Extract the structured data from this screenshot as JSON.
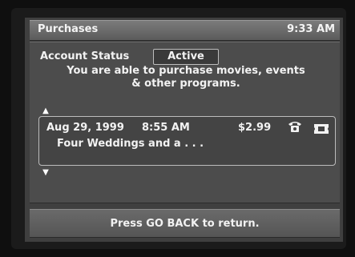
{
  "header": {
    "title": "Purchases",
    "time": "9:33 AM"
  },
  "account": {
    "status_label": "Account Status",
    "status_value": "Active",
    "message_line1": "You are able to purchase movies, events",
    "message_line2": "& other programs."
  },
  "scroll": {
    "up_icon": "triangle-up-icon",
    "down_icon": "triangle-down-icon"
  },
  "purchases": [
    {
      "date": "Aug 29, 1999",
      "time": "8:55 AM",
      "price": "$2.99",
      "title": "Four Weddings and a . . .",
      "icons": [
        "telephone-icon",
        "ticket-icon"
      ]
    }
  ],
  "footer": {
    "instruction": "Press GO BACK to return."
  }
}
